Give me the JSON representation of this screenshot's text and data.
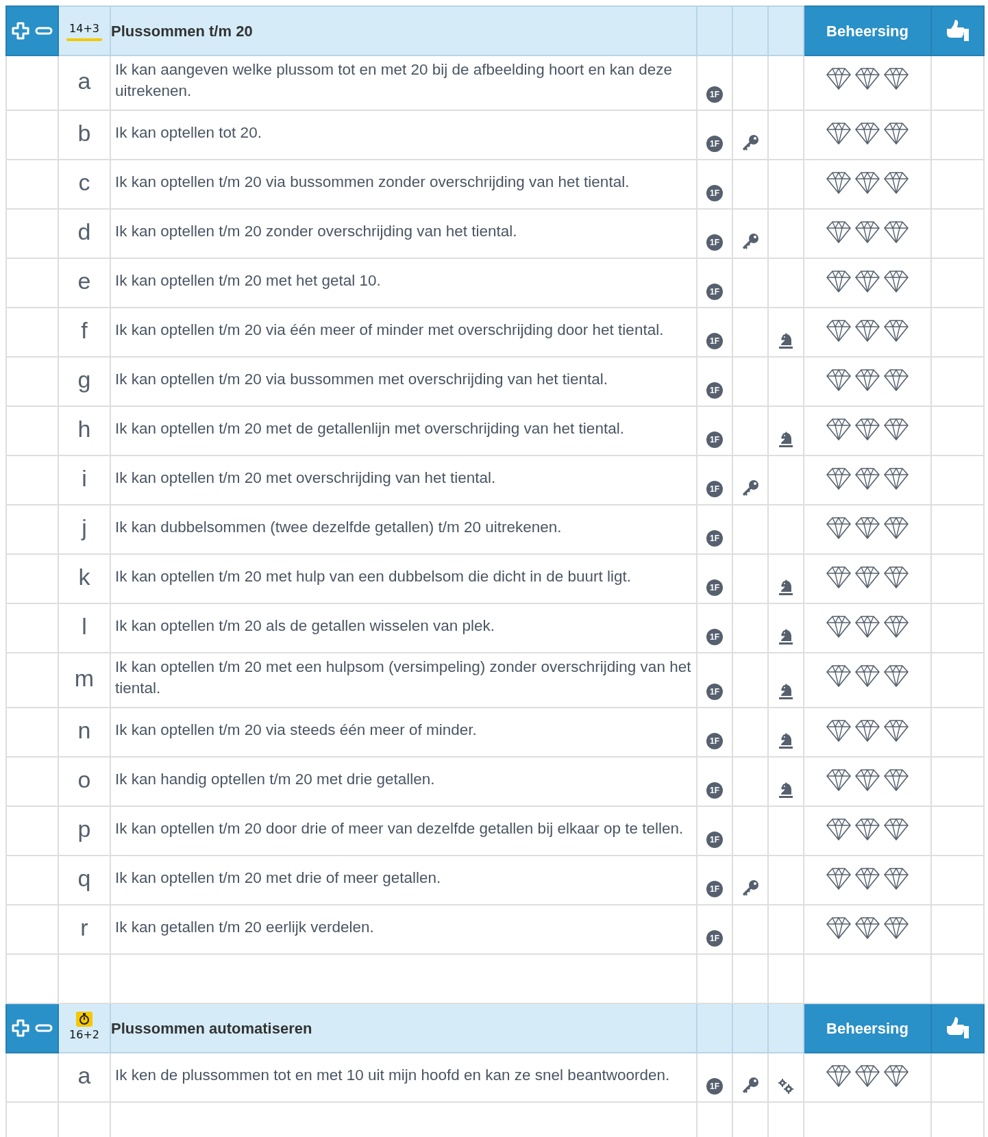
{
  "sections": [
    {
      "badge": "14+3",
      "timed": false,
      "title": "Plussommen t/m 20",
      "mastery_label": "Beheersing",
      "rows": [
        {
          "letter": "a",
          "text": "Ik kan aangeven welke plussom tot en met 20 bij de afbeelding hoort en kan deze uitrekenen.",
          "level": "1F",
          "key": false,
          "knight": false,
          "gears": false
        },
        {
          "letter": "b",
          "text": "Ik kan optellen tot 20.",
          "level": "1F",
          "key": true,
          "knight": false,
          "gears": false
        },
        {
          "letter": "c",
          "text": "Ik kan optellen t/m 20 via bussommen zonder overschrijding van het tiental.",
          "level": "1F",
          "key": false,
          "knight": false,
          "gears": false
        },
        {
          "letter": "d",
          "text": "Ik kan optellen t/m 20 zonder overschrijding van het tiental.",
          "level": "1F",
          "key": true,
          "knight": false,
          "gears": false
        },
        {
          "letter": "e",
          "text": "Ik kan optellen t/m 20 met het getal 10.",
          "level": "1F",
          "key": false,
          "knight": false,
          "gears": false
        },
        {
          "letter": "f",
          "text": "Ik kan optellen t/m 20 via één meer of minder met overschrijding door het tiental.",
          "level": "1F",
          "key": false,
          "knight": true,
          "gears": false
        },
        {
          "letter": "g",
          "text": "Ik kan optellen t/m 20 via bussommen met overschrijding van het tiental.",
          "level": "1F",
          "key": false,
          "knight": false,
          "gears": false
        },
        {
          "letter": "h",
          "text": "Ik kan optellen t/m 20 met de getallenlijn met overschrijding van het tiental.",
          "level": "1F",
          "key": false,
          "knight": true,
          "gears": false
        },
        {
          "letter": "i",
          "text": "Ik kan optellen t/m 20 met overschrijding van het tiental.",
          "level": "1F",
          "key": true,
          "knight": false,
          "gears": false
        },
        {
          "letter": "j",
          "text": "Ik kan dubbelsommen (twee dezelfde getallen) t/m 20 uitrekenen.",
          "level": "1F",
          "key": false,
          "knight": false,
          "gears": false
        },
        {
          "letter": "k",
          "text": "Ik kan optellen t/m 20 met hulp van een dubbelsom die dicht in de buurt ligt.",
          "level": "1F",
          "key": false,
          "knight": true,
          "gears": false
        },
        {
          "letter": "l",
          "text": "Ik kan optellen t/m 20 als de getallen wisselen van plek.",
          "level": "1F",
          "key": false,
          "knight": true,
          "gears": false
        },
        {
          "letter": "m",
          "text": "Ik kan optellen t/m 20 met een hulpsom (versimpeling) zonder overschrijding van het tiental.",
          "level": "1F",
          "key": false,
          "knight": true,
          "gears": false
        },
        {
          "letter": "n",
          "text": "Ik kan optellen t/m 20 via steeds één meer of minder.",
          "level": "1F",
          "key": false,
          "knight": true,
          "gears": false
        },
        {
          "letter": "o",
          "text": "Ik kan handig optellen t/m 20 met drie getallen.",
          "level": "1F",
          "key": false,
          "knight": true,
          "gears": false
        },
        {
          "letter": "p",
          "text": "Ik kan optellen t/m 20 door drie of meer van dezelfde getallen bij elkaar op te tellen.",
          "level": "1F",
          "key": false,
          "knight": false,
          "gears": false
        },
        {
          "letter": "q",
          "text": "Ik kan optellen t/m 20 met drie of meer getallen.",
          "level": "1F",
          "key": true,
          "knight": false,
          "gears": false
        },
        {
          "letter": "r",
          "text": "Ik kan getallen t/m 20 eerlijk verdelen.",
          "level": "1F",
          "key": false,
          "knight": false,
          "gears": false
        }
      ]
    },
    {
      "badge": "16+2",
      "timed": true,
      "title": "Plussommen automatiseren",
      "mastery_label": "Beheersing",
      "rows": [
        {
          "letter": "a",
          "text": "Ik ken de plussommen tot en met 10 uit mijn hoofd en kan ze snel beantwoorden.",
          "level": "1F",
          "key": true,
          "knight": false,
          "gears": true
        }
      ]
    }
  ]
}
